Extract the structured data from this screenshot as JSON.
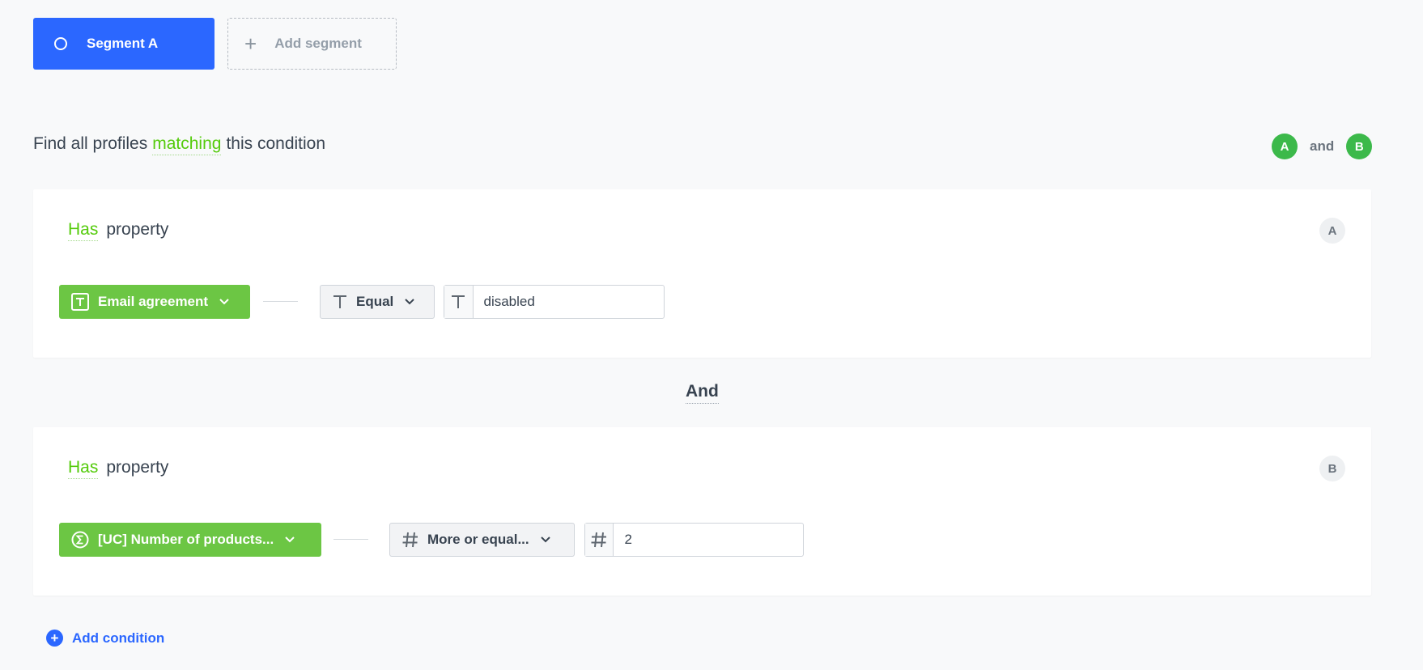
{
  "segments": {
    "active_label": "Segment A",
    "add_label": "Add segment"
  },
  "heading": {
    "prefix": "Find all profiles",
    "match_word": "matching",
    "suffix": "this condition"
  },
  "logic": {
    "left_badge": "A",
    "connector": "and",
    "right_badge": "B"
  },
  "conditions": [
    {
      "qualifier": "Has",
      "subject": "property",
      "badge": "A",
      "property_label": "Email agreement",
      "property_icon": "text-type-icon",
      "operator_label": "Equal",
      "operator_icon": "text-type-icon",
      "value_icon": "text-type-icon",
      "value": "disabled"
    },
    {
      "qualifier": "Has",
      "subject": "property",
      "badge": "B",
      "property_label": "[UC] Number of products...",
      "property_icon": "sigma-icon",
      "operator_label": "More or equal...",
      "operator_icon": "hash-icon",
      "value_icon": "hash-icon",
      "value": "2"
    }
  ],
  "join_label": "And",
  "add_condition_label": "Add condition",
  "colors": {
    "primary_blue": "#2b67ff",
    "property_green": "#6cc644",
    "link_green": "#54cb0b",
    "badge_green": "#3cb94a",
    "background": "#f8f9fa"
  }
}
